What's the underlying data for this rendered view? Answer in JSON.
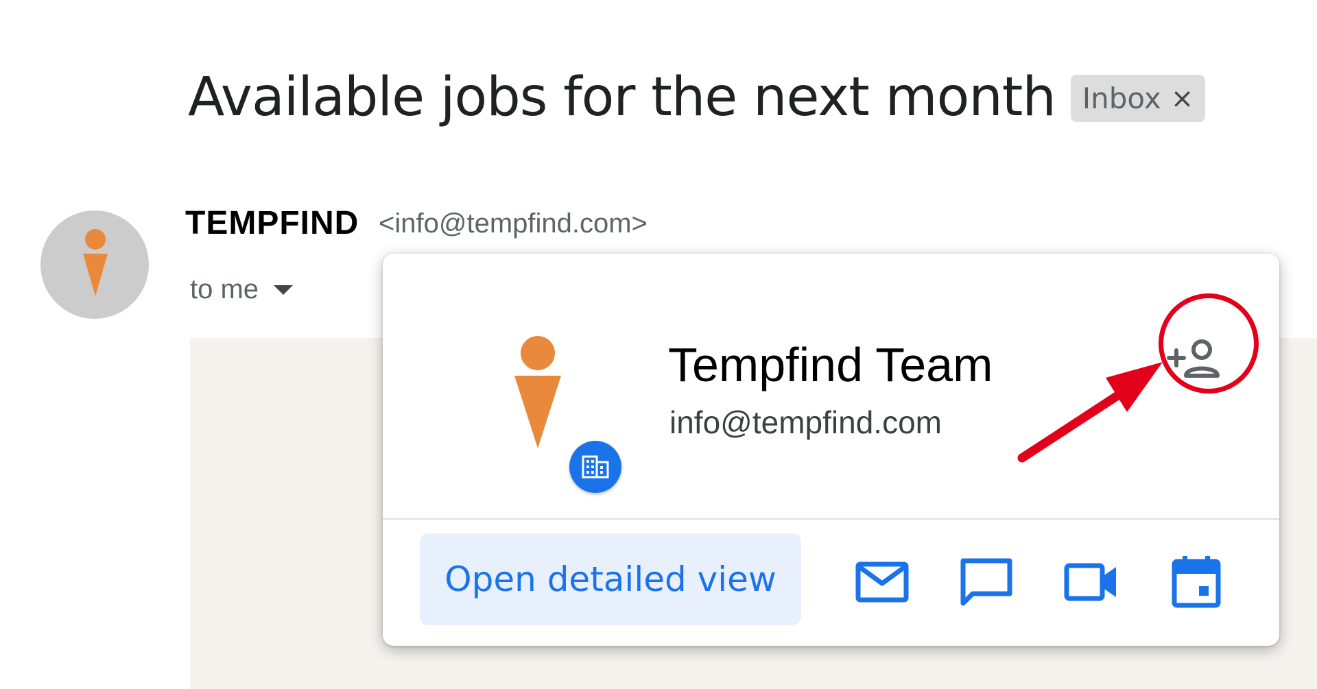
{
  "email": {
    "subject": "Available jobs for the next month",
    "label_chip": {
      "label": "Inbox",
      "remove_glyph": "×"
    },
    "sender": {
      "name": "TEMPFIND",
      "email": "<info@tempfind.com>"
    },
    "recipient_line": "to me"
  },
  "contact_card": {
    "name": "Tempfind Team",
    "email": "info@tempfind.com",
    "open_detail_label": "Open detailed view",
    "actions": [
      {
        "icon": "mail-icon"
      },
      {
        "icon": "chat-icon"
      },
      {
        "icon": "video-camera-icon"
      },
      {
        "icon": "calendar-icon"
      }
    ],
    "add_contact_icon": "add-person-icon",
    "org_badge_icon": "building-icon"
  },
  "annotation": {
    "color": "#e3001b",
    "points_to": "add-contact-button"
  },
  "colors": {
    "accent": "#1a73e8",
    "logo_orange": "#e8893c",
    "avatar_bg": "#cccccc"
  }
}
